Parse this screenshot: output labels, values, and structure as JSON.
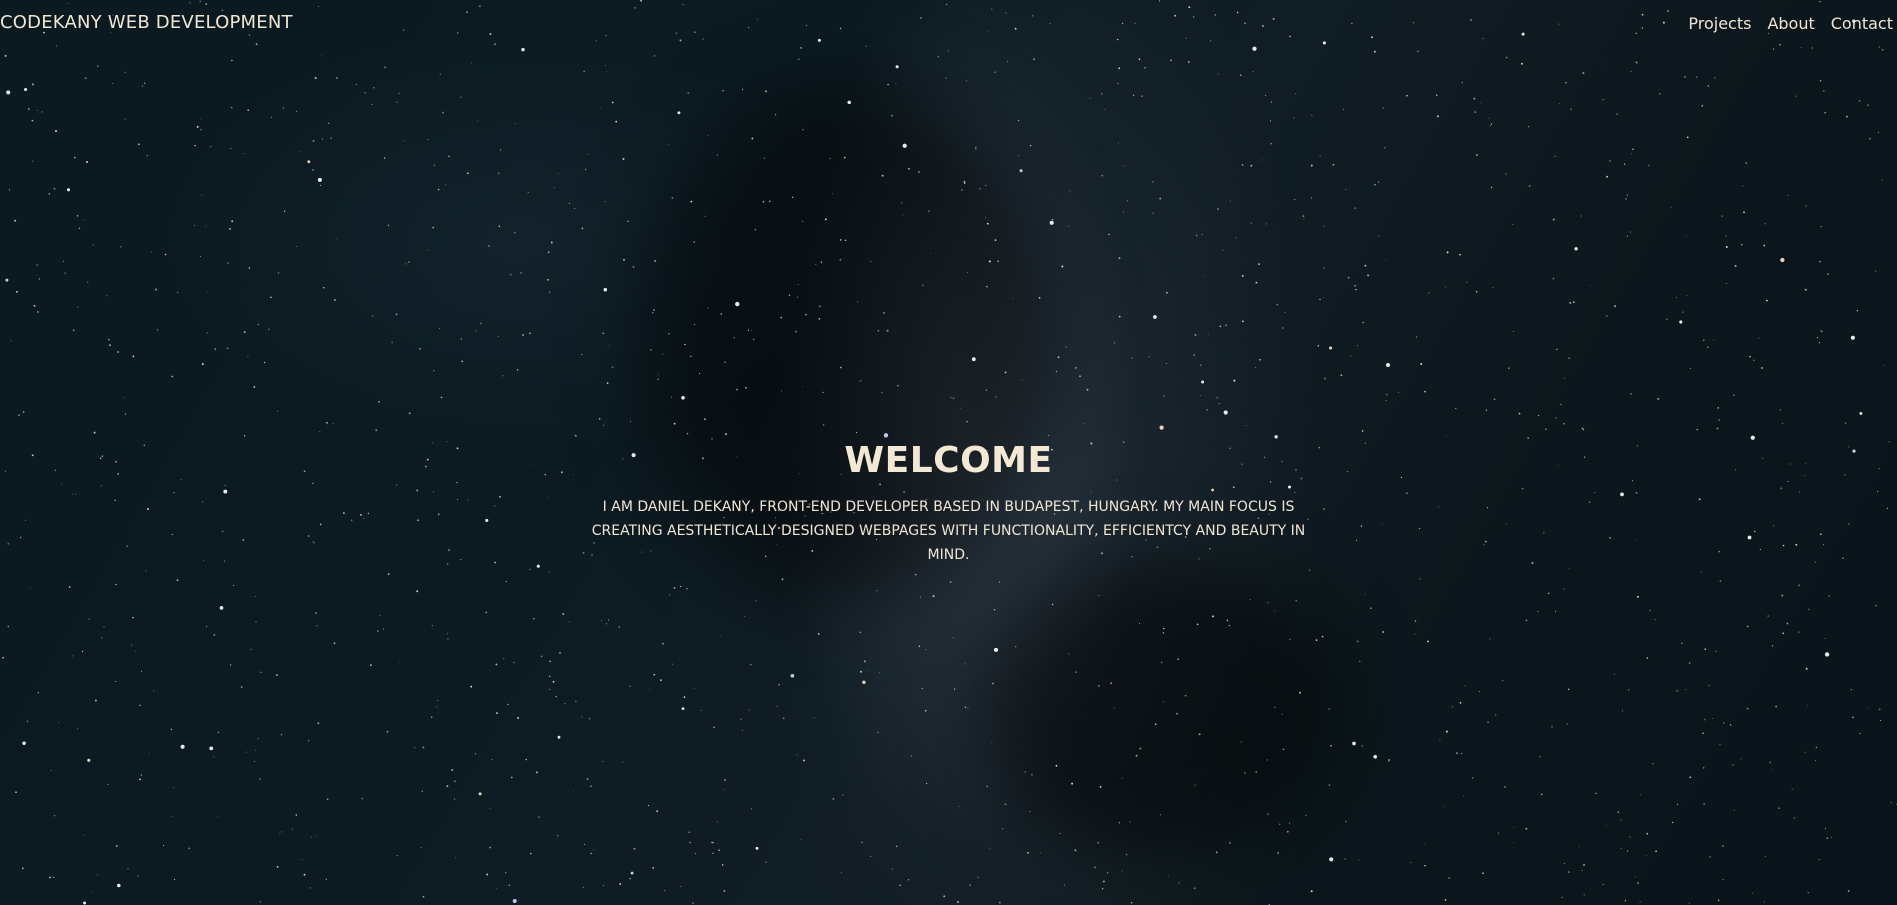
{
  "header": {
    "brand": "CODEKANY WEB DEVELOPMENT",
    "nav": [
      {
        "label": "Projects"
      },
      {
        "label": "About"
      },
      {
        "label": "Contact"
      }
    ]
  },
  "hero": {
    "title": "WELCOME",
    "intro": "I AM DANIEL DEKANY, FRONT-END DEVELOPER BASED IN BUDAPEST, HUNGARY. MY MAIN FOCUS IS CREATING AESTHETICALLY DESIGNED WEBPAGES WITH FUNCTIONALITY, EFFICIENTCY AND BEAUTY IN MIND."
  },
  "colors": {
    "text": "#f1e6d2",
    "background": "#0a1418"
  }
}
